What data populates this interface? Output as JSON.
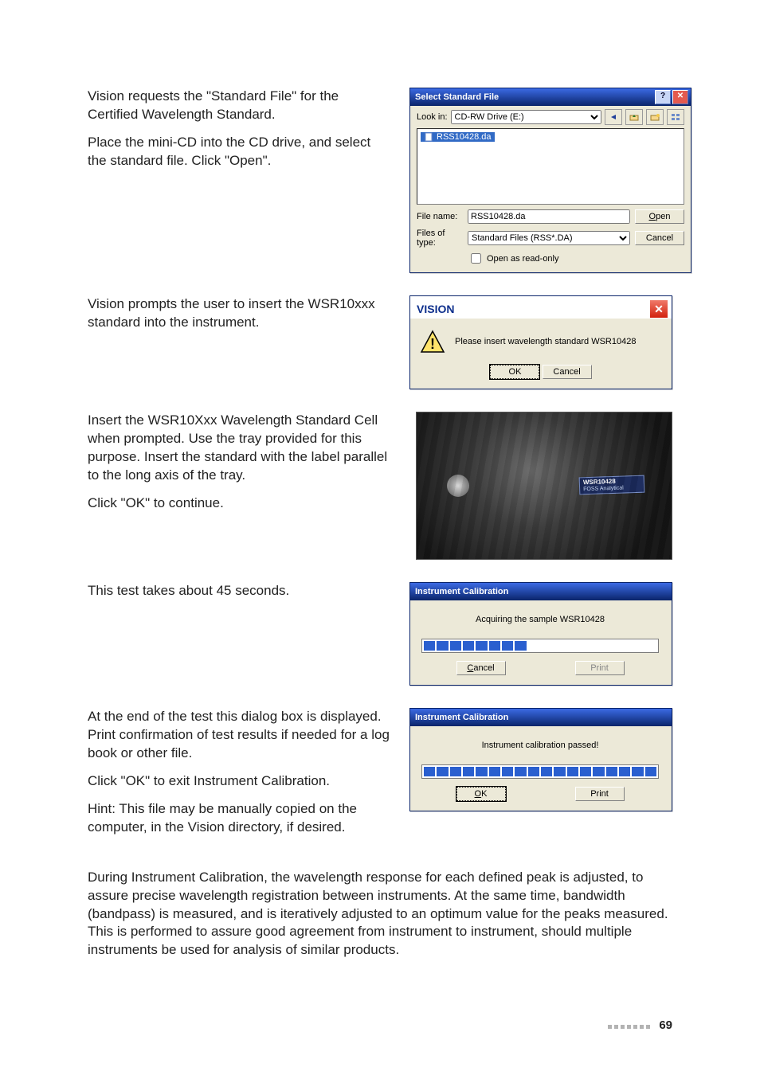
{
  "para": {
    "p1": "Vision requests the \"Standard File\" for the Certified Wavelength Standard.",
    "p2": "Place the mini-CD into the CD drive, and select the standard file. Click \"Open\".",
    "p3": "Vision prompts the user to insert the WSR10xxx standard into the instrument.",
    "p4": "Insert the WSR10Xxx Wavelength Standard Cell when prompted. Use the tray provided for this purpose. Insert the standard with the label parallel to the long axis of the tray.",
    "p5": "Click \"OK\" to continue.",
    "p6": "This test takes about 45 seconds.",
    "p7": "At the end of the test this dialog box is displayed. Print confirmation of test results if needed for a log book or other file.",
    "p8": "Click \"OK\" to exit Instrument Calibration.",
    "p9": "Hint: This file may be manually copied on the computer, in the Vision directory, if desired.",
    "p10": "During Instrument Calibration, the wavelength response for each defined peak is adjusted, to assure precise wavelength registration between instruments. At the same time, bandwidth (bandpass) is measured, and is iteratively adjusted to an optimum value for the peaks measured. This is performed to assure good agreement from instrument to instrument, should multiple instruments be used for analysis of similar products."
  },
  "fileDialog": {
    "title": "Select Standard File",
    "lookInLabel": "Look in:",
    "lookInValue": "CD-RW Drive (E:)",
    "fileItem": "RSS10428.da",
    "fileNameLabel": "File name:",
    "fileNameValue": "RSS10428.da",
    "fileTypeLabel": "Files of type:",
    "fileTypeValue": "Standard Files (RSS*.DA)",
    "openBtn": "Open",
    "cancelBtn": "Cancel",
    "readOnly": "Open as read-only"
  },
  "visionDialog": {
    "title": "VISION",
    "message": "Please insert wavelength standard WSR10428",
    "ok": "OK",
    "cancel": "Cancel"
  },
  "photo": {
    "labelTitle": "WSR10428",
    "labelSub": "FOSS Analytical"
  },
  "prog1": {
    "title": "Instrument Calibration",
    "msg": "Acquiring the sample WSR10428",
    "cancel": "Cancel",
    "print": "Print",
    "segments": 18,
    "filled": 8
  },
  "prog2": {
    "title": "Instrument Calibration",
    "msg": "Instrument calibration passed!",
    "ok": "OK",
    "print": "Print",
    "segments": 18,
    "filled": 18
  },
  "footer": {
    "page": "69"
  }
}
